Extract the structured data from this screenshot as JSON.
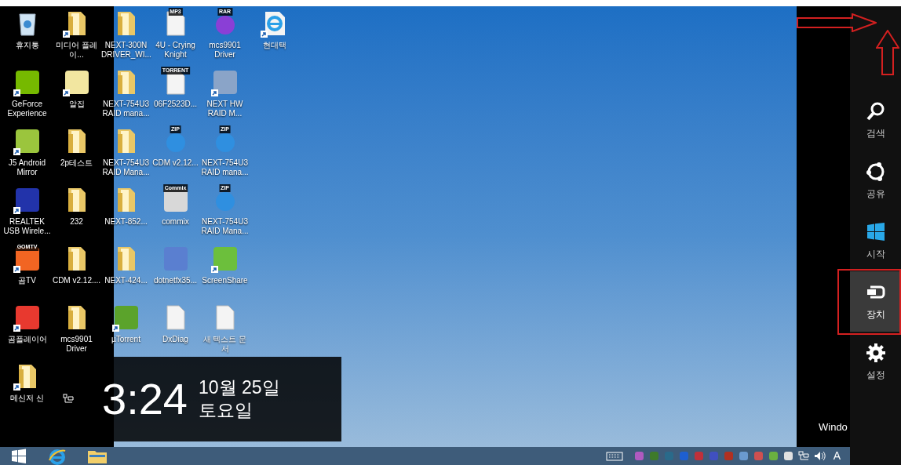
{
  "desktop": {
    "columns": [
      [
        {
          "label": "휴지통",
          "kind": "recycle",
          "shortcut": false
        },
        {
          "label": "GeForce Experience",
          "kind": "app",
          "color": "#76b900",
          "shortcut": true
        },
        {
          "label": "J5 Android Mirror",
          "kind": "app",
          "color": "#9bc53d",
          "shortcut": true
        },
        {
          "label": "REALTEK USB Wirele...",
          "kind": "app",
          "color": "#2233aa",
          "shortcut": true
        },
        {
          "label": "곰TV",
          "kind": "app",
          "color": "#f26522",
          "badge": "GOMTV",
          "shortcut": true
        },
        {
          "label": "곰플레이어",
          "kind": "app",
          "color": "#e8392f",
          "shortcut": true
        },
        {
          "label": "메신저 신",
          "kind": "folder",
          "shortcut": true
        }
      ],
      [
        {
          "label": "미디어 플레이...",
          "kind": "folder",
          "shortcut": true
        },
        {
          "label": "알집",
          "kind": "app",
          "color": "#f2e6a0",
          "shortcut": true
        },
        {
          "label": "2p테스트",
          "kind": "folder",
          "shortcut": false
        },
        {
          "label": "232",
          "kind": "folder",
          "shortcut": false
        },
        {
          "label": "CDM v2.12....",
          "kind": "folder",
          "shortcut": false
        },
        {
          "label": "mcs9901 Driver",
          "kind": "folder",
          "shortcut": false
        }
      ],
      [
        {
          "label": "NEXT-300N DRIVER_WI...",
          "kind": "folder",
          "shortcut": false
        },
        {
          "label": "NEXT-754U3 RAID mana...",
          "kind": "folder",
          "shortcut": false
        },
        {
          "label": "NEXT-754U3 RAID Mana...",
          "kind": "folder",
          "shortcut": false
        },
        {
          "label": "NEXT-852...",
          "kind": "folder",
          "shortcut": false
        },
        {
          "label": "NEXT-424...",
          "kind": "folder",
          "shortcut": false
        },
        {
          "label": "µTorrent",
          "kind": "app",
          "color": "#5ba32b",
          "shortcut": true
        }
      ],
      [
        {
          "label": "4U - Crying Knight",
          "kind": "file",
          "badge": "MP3",
          "shortcut": false
        },
        {
          "label": "06F2523D...",
          "kind": "file",
          "badge": "TORRENT",
          "shortcut": false
        },
        {
          "label": "CDM v2.12...",
          "kind": "zip",
          "badge": "ZIP",
          "shortcut": false
        },
        {
          "label": "commix",
          "kind": "app",
          "color": "#d8d8d8",
          "badge": "Commix",
          "shortcut": false
        },
        {
          "label": "dotnetfx35...",
          "kind": "app",
          "color": "#5a7fd0",
          "shortcut": false
        },
        {
          "label": "DxDiag",
          "kind": "file",
          "shortcut": false
        }
      ],
      [
        {
          "label": "mcs9901 Driver",
          "kind": "zip",
          "badge": "RAR",
          "shortcut": false
        },
        {
          "label": "NEXT HW RAID M...",
          "kind": "app",
          "color": "#8aa4c8",
          "shortcut": true
        },
        {
          "label": "NEXT-754U3 RAID mana...",
          "kind": "zip",
          "badge": "ZIP",
          "shortcut": false
        },
        {
          "label": "NEXT-754U3 RAID Mana...",
          "kind": "zip",
          "badge": "ZIP",
          "shortcut": false
        },
        {
          "label": "ScreenShare",
          "kind": "app",
          "color": "#6cbf3c",
          "shortcut": true
        },
        {
          "label": "새 텍스트 문서",
          "kind": "file",
          "shortcut": false
        }
      ],
      [
        {
          "label": "현대택",
          "kind": "ie",
          "shortcut": true
        }
      ]
    ]
  },
  "clock": {
    "time": "3:24",
    "date": "10월 25일",
    "weekday": "토요일"
  },
  "hidden_window_text": "Windo",
  "charms": [
    {
      "label": "검색",
      "kind": "search",
      "selected": false
    },
    {
      "label": "공유",
      "kind": "share",
      "selected": false
    },
    {
      "label": "시작",
      "kind": "start",
      "selected": false
    },
    {
      "label": "장치",
      "kind": "devices",
      "selected": true
    },
    {
      "label": "설정",
      "kind": "settings",
      "selected": false
    }
  ],
  "taskbar": {
    "input_indicator": "A"
  }
}
